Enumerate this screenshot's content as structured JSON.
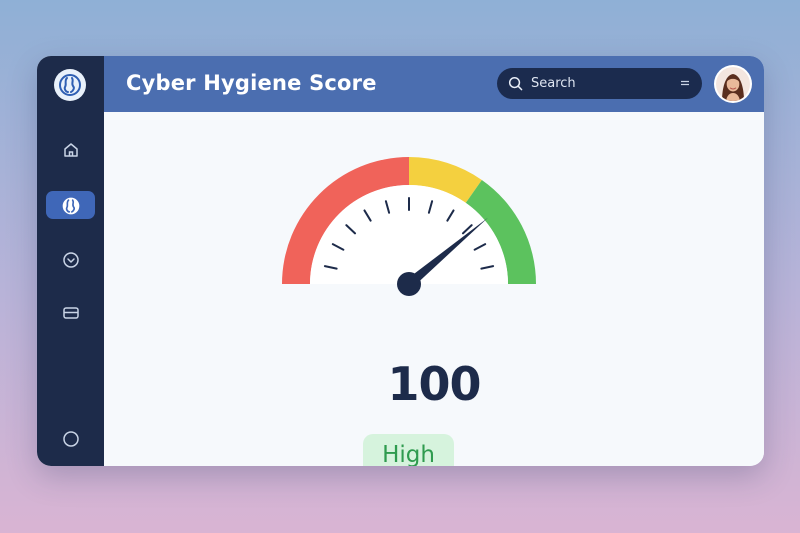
{
  "app": {
    "title": "Cyber Hygiene Score"
  },
  "search": {
    "placeholder": "Search"
  },
  "sidebar": {
    "items": [
      {
        "name": "home",
        "icon": "home-icon",
        "active": false
      },
      {
        "name": "hygiene",
        "icon": "brand-icon",
        "active": true
      },
      {
        "name": "dropdown",
        "icon": "chevron-down-circle-icon",
        "active": false
      },
      {
        "name": "cards",
        "icon": "card-icon",
        "active": false
      },
      {
        "name": "profile",
        "icon": "circle-icon",
        "active": false
      }
    ]
  },
  "gauge": {
    "value": 100,
    "value_label": "100",
    "rating": "High",
    "segments": [
      {
        "color": "#f0635a"
      },
      {
        "color": "#f4d03f"
      },
      {
        "color": "#5cc25e"
      }
    ],
    "needle_color": "#1d2b4a"
  },
  "colors": {
    "sidebar": "#1d2b4a",
    "header": "#4b6eb0",
    "accent_active": "#3f67b8",
    "badge_bg": "#d6f3dd",
    "badge_text": "#2f9b4f"
  }
}
